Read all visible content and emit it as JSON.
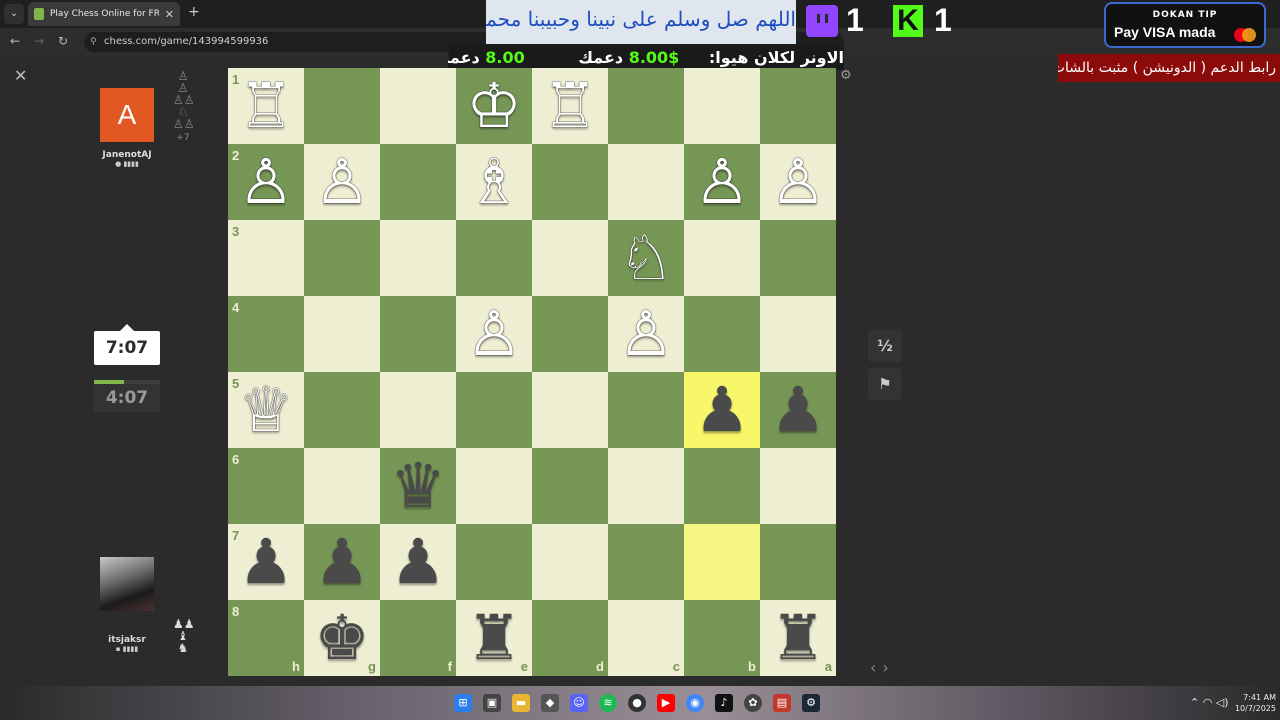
{
  "browser": {
    "tab_title": "Play Chess Online for FREE",
    "url": "chess.com/game/143994599936",
    "new_tab": "+",
    "tab_close": "✕",
    "menu": "⌄"
  },
  "overlay": {
    "arabic_banner": "اللهم صل وسلم على نبينا وحبيبنا محمد",
    "twitch_count": "1",
    "kick_label": "K",
    "kick_count": "1",
    "dokan_title": "DOKAN TIP",
    "dokan_payments": "Pay VISA mada",
    "ticker_left": "الاونر لكلان هيوا:",
    "ticker_amount_1": "$8.00",
    "ticker_suffix_1": "دعمك",
    "ticker_amount_2": "8.00",
    "ticker_suffix_2": "دعمك",
    "support_text": "رابط الدعم ( الدونيشن ) مثبت بالشات"
  },
  "players": {
    "top": {
      "name": "JanenotAJ",
      "initial": "A",
      "clock": "7:07"
    },
    "bottom": {
      "name": "itsjaksr",
      "clock": "4:07"
    },
    "top_captured_more": "+7"
  },
  "clock_progress": 0.45,
  "controls": {
    "draw_label": "½",
    "resign_icon": "⚑",
    "prev": "‹",
    "next": "›",
    "close": "✕",
    "settings": "⚙"
  },
  "board": {
    "orientation": "black",
    "ranks": [
      "1",
      "2",
      "3",
      "4",
      "5",
      "6",
      "7",
      "8"
    ],
    "files": [
      "h",
      "g",
      "f",
      "e",
      "d",
      "c",
      "b",
      "a"
    ],
    "highlights": [
      "b5",
      "b7"
    ],
    "pieces": {
      "h1": "♖",
      "e1": "♔",
      "d1": "♖",
      "h2": "♙",
      "g2": "♙",
      "e2": "♗",
      "b2": "♙",
      "a2": "♙",
      "c3": "♘",
      "e4": "♙",
      "c4": "♙",
      "h5": "♕",
      "b5": "♟",
      "a5": "♟",
      "f6": "♛",
      "h7": "♟",
      "g7": "♟",
      "f7": "♟",
      "g8": "♚",
      "e8": "♜",
      "a8": "♜"
    }
  },
  "system": {
    "time": "7:41 AM",
    "date": "10/7/2025"
  }
}
